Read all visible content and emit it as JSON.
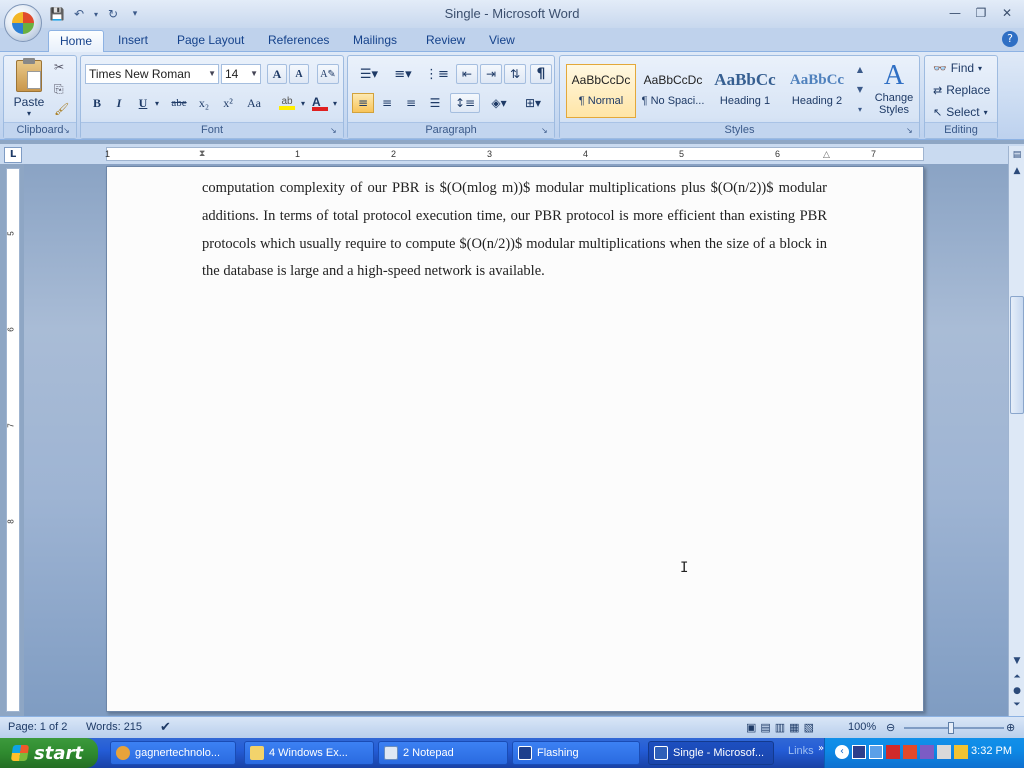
{
  "window": {
    "title": "Single - Microsoft Word"
  },
  "tabs": [
    {
      "label": "Home",
      "active": true
    },
    {
      "label": "Insert"
    },
    {
      "label": "Page Layout"
    },
    {
      "label": "References"
    },
    {
      "label": "Mailings"
    },
    {
      "label": "Review"
    },
    {
      "label": "View"
    }
  ],
  "clipboard": {
    "paste_label": "Paste",
    "group_label": "Clipboard"
  },
  "font": {
    "name": "Times New Roman",
    "size": "14",
    "group_label": "Font",
    "bold": "B",
    "italic": "I",
    "underline": "U",
    "strike": "abe",
    "sub": "x₂",
    "sup": "x²",
    "case": "Aa",
    "grow": "A",
    "shrink": "A"
  },
  "paragraph": {
    "group_label": "Paragraph"
  },
  "styles": {
    "group_label": "Styles",
    "items": [
      {
        "sample": "AaBbCcDc",
        "name": "¶ Normal"
      },
      {
        "sample": "AaBbCcDc",
        "name": "¶ No Spaci..."
      },
      {
        "sample": "AaBbCc",
        "name": "Heading 1"
      },
      {
        "sample": "AaBbCc",
        "name": "Heading 2"
      }
    ],
    "change_label_1": "Change",
    "change_label_2": "Styles"
  },
  "editing": {
    "group_label": "Editing",
    "find": "Find",
    "replace": "Replace",
    "select": "Select"
  },
  "ruler": {
    "numbers": [
      "1",
      "1",
      "2",
      "3",
      "4",
      "5",
      "6",
      "7"
    ],
    "vnumbers": [
      "5",
      "6",
      "7",
      "8"
    ]
  },
  "document": {
    "paragraph": "computation complexity of our PBR is $(O(mlog m))$ modular multiplications plus $(O(n/2))$ modular additions. In terms of total protocol execution time, our PBR protocol is more efficient than existing PBR protocols which usually require to compute $(O(n/2))$ modular multiplications when the size of a block in the database is large and a high-speed network is available."
  },
  "status": {
    "page": "Page: 1 of 2",
    "words": "Words: 215",
    "zoom": "100%"
  },
  "taskbar": {
    "start": "start",
    "items": [
      {
        "label": "gagnertechnolo..."
      },
      {
        "label": "4 Windows Ex..."
      },
      {
        "label": "2 Notepad"
      },
      {
        "label": "Flashing"
      },
      {
        "label": "Single - Microsof..."
      }
    ],
    "links": "Links",
    "clock": "3:32 PM"
  }
}
